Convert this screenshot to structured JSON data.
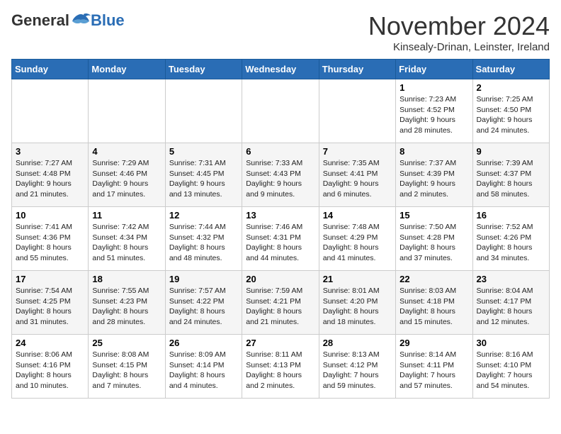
{
  "logo": {
    "general": "General",
    "blue": "Blue"
  },
  "header": {
    "month_title": "November 2024",
    "subtitle": "Kinsealy-Drinan, Leinster, Ireland"
  },
  "weekdays": [
    "Sunday",
    "Monday",
    "Tuesday",
    "Wednesday",
    "Thursday",
    "Friday",
    "Saturday"
  ],
  "weeks": [
    [
      {
        "day": "",
        "info": ""
      },
      {
        "day": "",
        "info": ""
      },
      {
        "day": "",
        "info": ""
      },
      {
        "day": "",
        "info": ""
      },
      {
        "day": "",
        "info": ""
      },
      {
        "day": "1",
        "info": "Sunrise: 7:23 AM\nSunset: 4:52 PM\nDaylight: 9 hours and 28 minutes."
      },
      {
        "day": "2",
        "info": "Sunrise: 7:25 AM\nSunset: 4:50 PM\nDaylight: 9 hours and 24 minutes."
      }
    ],
    [
      {
        "day": "3",
        "info": "Sunrise: 7:27 AM\nSunset: 4:48 PM\nDaylight: 9 hours and 21 minutes."
      },
      {
        "day": "4",
        "info": "Sunrise: 7:29 AM\nSunset: 4:46 PM\nDaylight: 9 hours and 17 minutes."
      },
      {
        "day": "5",
        "info": "Sunrise: 7:31 AM\nSunset: 4:45 PM\nDaylight: 9 hours and 13 minutes."
      },
      {
        "day": "6",
        "info": "Sunrise: 7:33 AM\nSunset: 4:43 PM\nDaylight: 9 hours and 9 minutes."
      },
      {
        "day": "7",
        "info": "Sunrise: 7:35 AM\nSunset: 4:41 PM\nDaylight: 9 hours and 6 minutes."
      },
      {
        "day": "8",
        "info": "Sunrise: 7:37 AM\nSunset: 4:39 PM\nDaylight: 9 hours and 2 minutes."
      },
      {
        "day": "9",
        "info": "Sunrise: 7:39 AM\nSunset: 4:37 PM\nDaylight: 8 hours and 58 minutes."
      }
    ],
    [
      {
        "day": "10",
        "info": "Sunrise: 7:41 AM\nSunset: 4:36 PM\nDaylight: 8 hours and 55 minutes."
      },
      {
        "day": "11",
        "info": "Sunrise: 7:42 AM\nSunset: 4:34 PM\nDaylight: 8 hours and 51 minutes."
      },
      {
        "day": "12",
        "info": "Sunrise: 7:44 AM\nSunset: 4:32 PM\nDaylight: 8 hours and 48 minutes."
      },
      {
        "day": "13",
        "info": "Sunrise: 7:46 AM\nSunset: 4:31 PM\nDaylight: 8 hours and 44 minutes."
      },
      {
        "day": "14",
        "info": "Sunrise: 7:48 AM\nSunset: 4:29 PM\nDaylight: 8 hours and 41 minutes."
      },
      {
        "day": "15",
        "info": "Sunrise: 7:50 AM\nSunset: 4:28 PM\nDaylight: 8 hours and 37 minutes."
      },
      {
        "day": "16",
        "info": "Sunrise: 7:52 AM\nSunset: 4:26 PM\nDaylight: 8 hours and 34 minutes."
      }
    ],
    [
      {
        "day": "17",
        "info": "Sunrise: 7:54 AM\nSunset: 4:25 PM\nDaylight: 8 hours and 31 minutes."
      },
      {
        "day": "18",
        "info": "Sunrise: 7:55 AM\nSunset: 4:23 PM\nDaylight: 8 hours and 28 minutes."
      },
      {
        "day": "19",
        "info": "Sunrise: 7:57 AM\nSunset: 4:22 PM\nDaylight: 8 hours and 24 minutes."
      },
      {
        "day": "20",
        "info": "Sunrise: 7:59 AM\nSunset: 4:21 PM\nDaylight: 8 hours and 21 minutes."
      },
      {
        "day": "21",
        "info": "Sunrise: 8:01 AM\nSunset: 4:20 PM\nDaylight: 8 hours and 18 minutes."
      },
      {
        "day": "22",
        "info": "Sunrise: 8:03 AM\nSunset: 4:18 PM\nDaylight: 8 hours and 15 minutes."
      },
      {
        "day": "23",
        "info": "Sunrise: 8:04 AM\nSunset: 4:17 PM\nDaylight: 8 hours and 12 minutes."
      }
    ],
    [
      {
        "day": "24",
        "info": "Sunrise: 8:06 AM\nSunset: 4:16 PM\nDaylight: 8 hours and 10 minutes."
      },
      {
        "day": "25",
        "info": "Sunrise: 8:08 AM\nSunset: 4:15 PM\nDaylight: 8 hours and 7 minutes."
      },
      {
        "day": "26",
        "info": "Sunrise: 8:09 AM\nSunset: 4:14 PM\nDaylight: 8 hours and 4 minutes."
      },
      {
        "day": "27",
        "info": "Sunrise: 8:11 AM\nSunset: 4:13 PM\nDaylight: 8 hours and 2 minutes."
      },
      {
        "day": "28",
        "info": "Sunrise: 8:13 AM\nSunset: 4:12 PM\nDaylight: 7 hours and 59 minutes."
      },
      {
        "day": "29",
        "info": "Sunrise: 8:14 AM\nSunset: 4:11 PM\nDaylight: 7 hours and 57 minutes."
      },
      {
        "day": "30",
        "info": "Sunrise: 8:16 AM\nSunset: 4:10 PM\nDaylight: 7 hours and 54 minutes."
      }
    ]
  ]
}
